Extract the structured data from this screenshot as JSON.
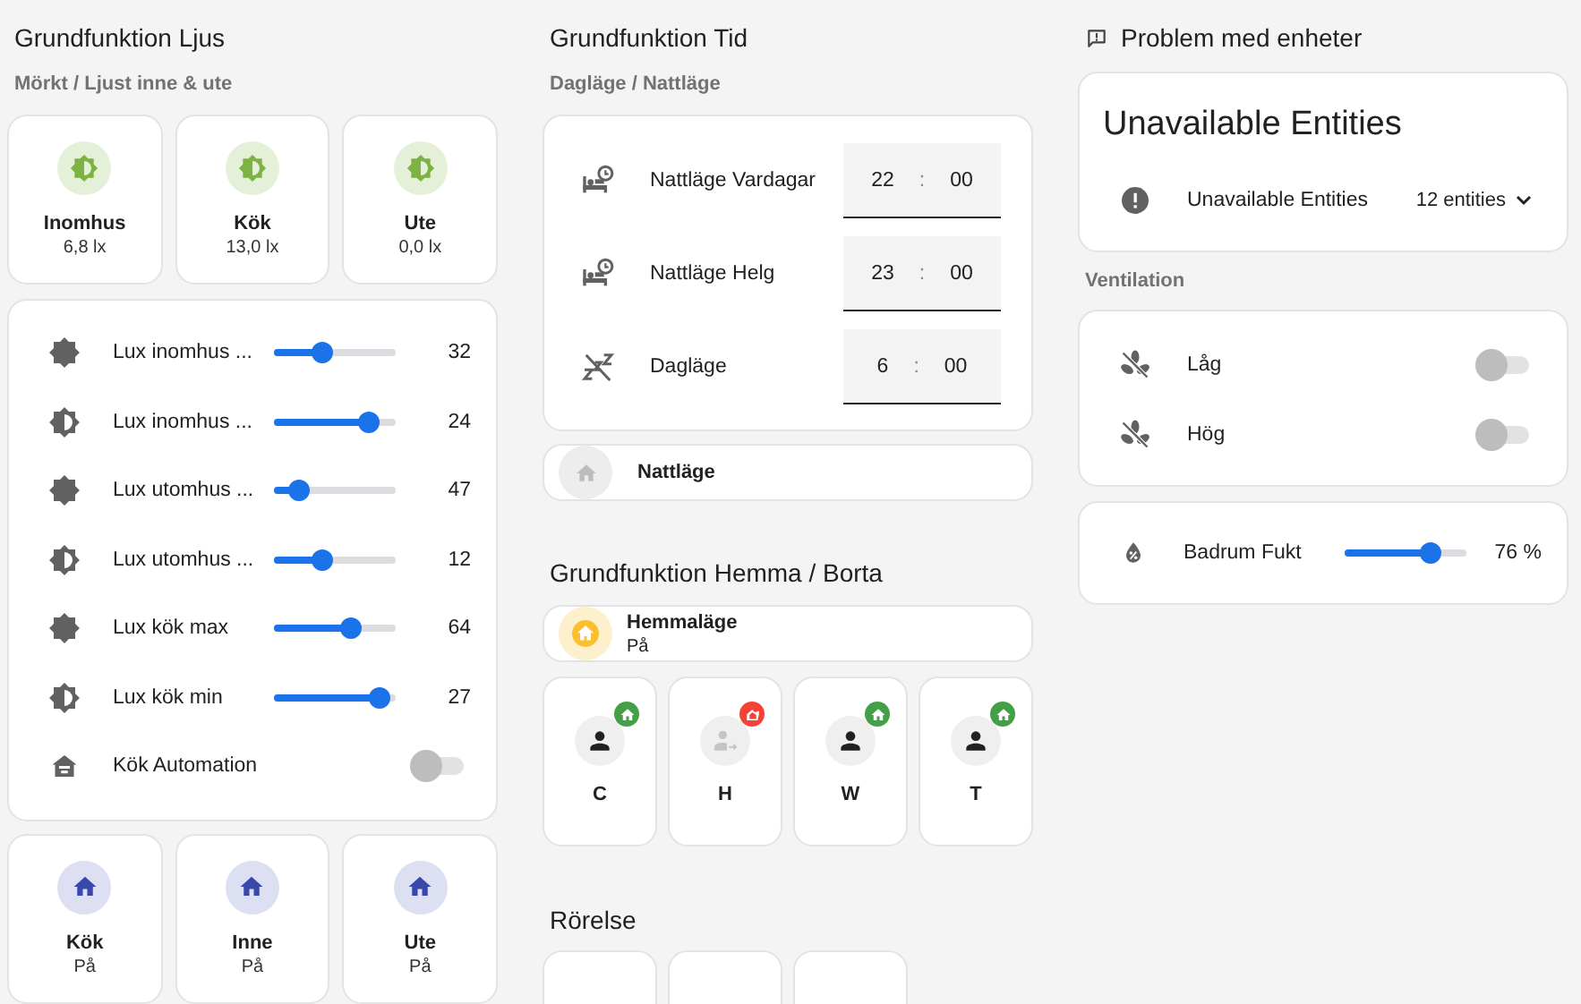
{
  "light": {
    "title": "Grundfunktion Ljus",
    "subtitle": "Mörkt / Ljust inne & ute",
    "sensors": [
      {
        "name": "Inomhus",
        "value": "6,8 lx"
      },
      {
        "name": "Kök",
        "value": "13,0 lx"
      },
      {
        "name": "Ute",
        "value": "0,0 lx"
      }
    ],
    "controls": [
      {
        "kind": "slider",
        "name": "Lux inomhus ...",
        "level": 0.4,
        "reading": "32"
      },
      {
        "kind": "slider",
        "name": "Lux inomhus ...",
        "level": 0.78,
        "reading": "24"
      },
      {
        "kind": "slider",
        "name": "Lux utomhus ...",
        "level": 0.21,
        "reading": "47"
      },
      {
        "kind": "slider",
        "name": "Lux utomhus ...",
        "level": 0.4,
        "reading": "12"
      },
      {
        "kind": "slider",
        "name": "Lux kök max",
        "level": 0.63,
        "reading": "64"
      },
      {
        "kind": "slider",
        "name": "Lux kök min",
        "level": 0.87,
        "reading": "27"
      },
      {
        "kind": "toggle",
        "name": "Kök Automation",
        "on": false
      }
    ],
    "modes": [
      {
        "name": "Kök",
        "state": "På"
      },
      {
        "name": "Inne",
        "state": "På"
      },
      {
        "name": "Ute",
        "state": "På"
      }
    ]
  },
  "time": {
    "title": "Grundfunktion Tid",
    "subtitle": "Dagläge / Nattläge",
    "schedules": [
      {
        "name": "Nattläge Vardagar",
        "hour": "22",
        "separator": ":",
        "minute": "00"
      },
      {
        "name": "Nattläge Helg",
        "hour": "23",
        "separator": ":",
        "minute": "00"
      },
      {
        "name": "Dagläge",
        "hour": "6",
        "separator": ":",
        "minute": "00"
      }
    ],
    "night_mode": {
      "name": "Nattläge",
      "on": false
    }
  },
  "presence": {
    "title": "Grundfunktion Hemma / Borta",
    "home_mode": {
      "name": "Hemmaläge",
      "state": "På",
      "on": true
    },
    "persons": [
      {
        "name": "C",
        "home": true
      },
      {
        "name": "H",
        "home": false
      },
      {
        "name": "W",
        "home": true
      },
      {
        "name": "T",
        "home": true
      }
    ]
  },
  "motion": {
    "title": "Rörelse",
    "tiles": [
      {
        "kind": "tile"
      },
      {
        "kind": "tile"
      },
      {
        "kind": "tile"
      }
    ]
  },
  "problems": {
    "title": "Problem med enheter",
    "card_title": "Unavailable Entities",
    "row": {
      "name": "Unavailable Entities",
      "count": "12 entities"
    }
  },
  "ventilation": {
    "title": "Ventilation",
    "fans": [
      {
        "name": "Låg",
        "on": false
      },
      {
        "name": "Hög",
        "on": false
      }
    ]
  },
  "humidity": {
    "name": "Badrum Fukt",
    "level": 0.71,
    "reading": "76 %"
  }
}
